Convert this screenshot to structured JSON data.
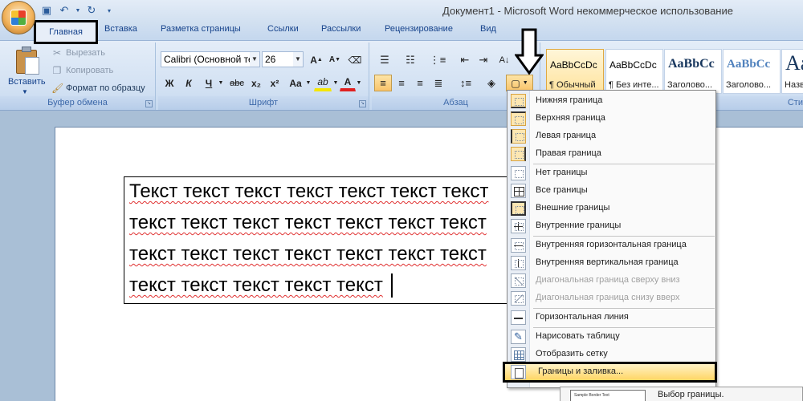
{
  "window": {
    "title": "Документ1 - Microsoft Word некоммерческое использование"
  },
  "quick_access": {
    "icons": [
      "save-icon",
      "undo-icon",
      "redo-icon",
      "customize-icon"
    ]
  },
  "tabs": {
    "active": "Главная",
    "items": [
      "Вставка",
      "Разметка страницы",
      "Ссылки",
      "Рассылки",
      "Рецензирование",
      "Вид"
    ]
  },
  "clipboard": {
    "paste_label": "Вставить",
    "cut_label": "Вырезать",
    "copy_label": "Копировать",
    "format_painter_label": "Формат по образцу",
    "group_label": "Буфер обмена"
  },
  "font": {
    "font_name": "Calibri (Основной те",
    "font_size": "26",
    "grow_icon": "grow-font-icon",
    "shrink_icon": "shrink-font-icon",
    "bold": "Ж",
    "italic": "К",
    "underline": "Ч",
    "strike": "abc",
    "subscript": "x₂",
    "superscript": "x²",
    "change_case": "Aa",
    "highlight": "ab",
    "font_color": "A",
    "group_label": "Шрифт",
    "accent_highlight": "#f5e600",
    "accent_font_color": "#e02020"
  },
  "paragraph": {
    "group_label": "Абзац",
    "active_alignment": "left"
  },
  "styles": {
    "items": [
      {
        "sample": "AaBbCcDc",
        "name": "¶ Обычный",
        "selected": true
      },
      {
        "sample": "AaBbCcDc",
        "name": "¶ Без инте..."
      },
      {
        "sample": "AaBbCc",
        "name": "Заголово..."
      },
      {
        "sample": "AaBbCc",
        "name": "Заголово..."
      },
      {
        "sample": "Aa",
        "name": "Назв"
      }
    ],
    "group_label": "Сти"
  },
  "document": {
    "lines": [
      "Текст текст текст текст текст текст текст",
      "текст текст текст текст текст текст текст",
      "текст текст текст текст текст текст текст",
      "текст текст текст текст текст"
    ]
  },
  "borders_menu": {
    "items": [
      {
        "label": "Нижняя граница",
        "icon": "bottom-border-icon"
      },
      {
        "label": "Верхняя граница",
        "icon": "top-border-icon"
      },
      {
        "label": "Левая граница",
        "icon": "left-border-icon"
      },
      {
        "label": "Правая граница",
        "icon": "right-border-icon"
      },
      {
        "label": "Нет границы",
        "icon": "no-border-icon"
      },
      {
        "label": "Все границы",
        "icon": "all-borders-icon"
      },
      {
        "label": "Внешние границы",
        "icon": "outside-borders-icon"
      },
      {
        "label": "Внутренние границы",
        "icon": "inside-borders-icon"
      },
      {
        "label": "Внутренняя горизонтальная граница",
        "icon": "inside-horizontal-border-icon"
      },
      {
        "label": "Внутренняя вертикальная граница",
        "icon": "inside-vertical-border-icon"
      },
      {
        "label": "Диагональная граница сверху вниз",
        "icon": "diagonal-down-border-icon",
        "disabled": true
      },
      {
        "label": "Диагональная граница снизу вверх",
        "icon": "diagonal-up-border-icon",
        "disabled": true
      },
      {
        "label": "Горизонтальная линия",
        "icon": "horizontal-line-icon"
      },
      {
        "label": "Нарисовать таблицу",
        "icon": "draw-table-icon"
      },
      {
        "label": "Отобразить сетку",
        "icon": "view-gridlines-icon"
      },
      {
        "label": "Границы и заливка...",
        "icon": "borders-shading-icon"
      }
    ]
  },
  "tooltip": {
    "text": "Выбор границы.",
    "thumb_text": "Sample Border Text"
  }
}
